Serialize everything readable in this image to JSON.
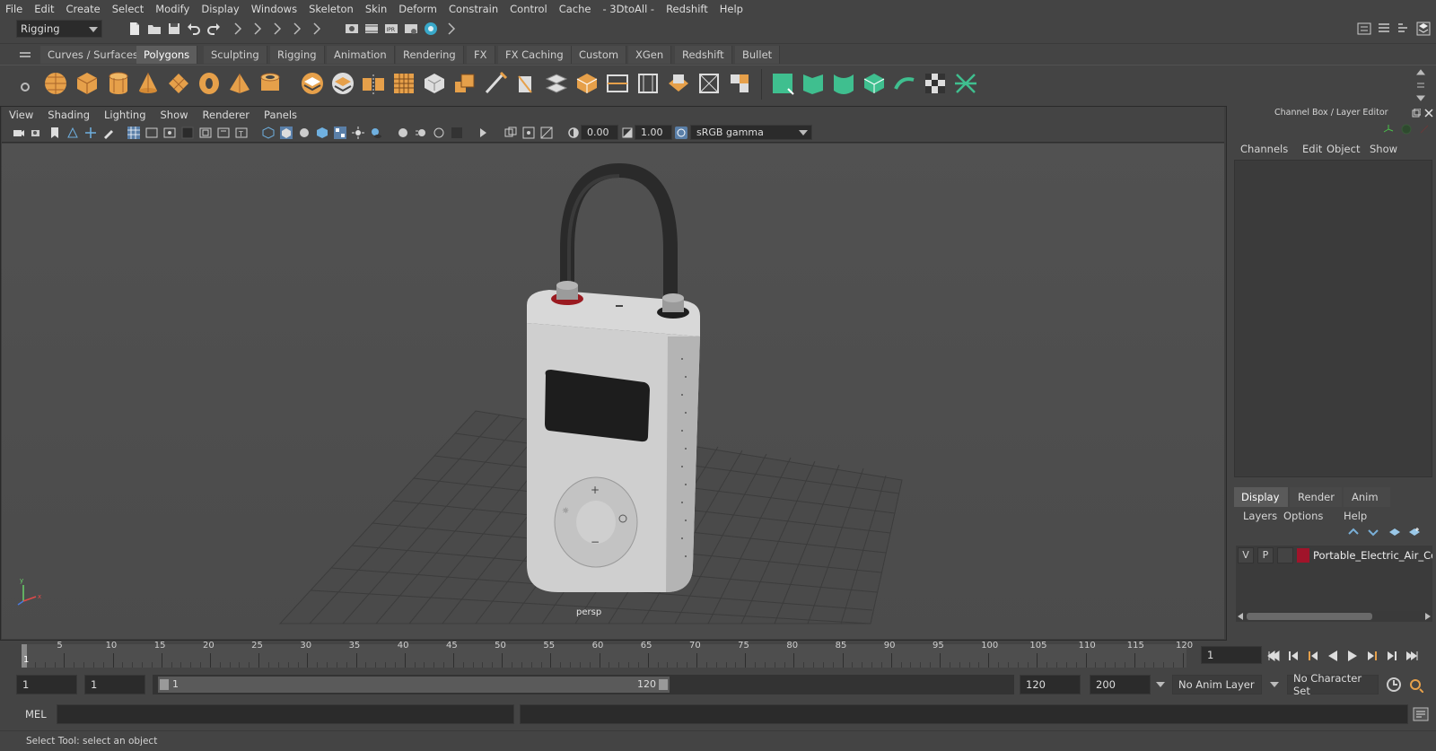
{
  "menu": [
    "File",
    "Edit",
    "Create",
    "Select",
    "Modify",
    "Display",
    "Windows",
    "Skeleton",
    "Skin",
    "Deform",
    "Constrain",
    "Control",
    "Cache",
    "- 3DtoAll -",
    "Redshift",
    "Help"
  ],
  "status": {
    "menu_set": "Rigging"
  },
  "shelf": {
    "tabs": [
      "Curves / Surfaces",
      "Polygons",
      "Sculpting",
      "Rigging",
      "Animation",
      "Rendering",
      "FX",
      "FX Caching",
      "Custom",
      "XGen",
      "Redshift",
      "Bullet"
    ],
    "active_tab": "Polygons"
  },
  "viewport": {
    "menu": [
      "View",
      "Shading",
      "Lighting",
      "Show",
      "Renderer",
      "Panels"
    ],
    "exposure": "0.00",
    "gamma": "1.00",
    "color_space": "sRGB gamma",
    "camera_label": "persp"
  },
  "right_panel": {
    "title": "Channel Box / Layer Editor",
    "channel_menu": [
      "Channels",
      "Edit",
      "Object",
      "Show"
    ],
    "layer_tabs": [
      "Display",
      "Render",
      "Anim"
    ],
    "active_layer_tab": "Display",
    "layer_menu": [
      "Layers",
      "Options",
      "Help"
    ],
    "layer": {
      "v": "V",
      "p": "P",
      "name": "Portable_Electric_Air_Cor",
      "color": "#a0142a"
    }
  },
  "timeline": {
    "ticks": [
      "5",
      "10",
      "15",
      "20",
      "25",
      "30",
      "35",
      "40",
      "45",
      "50",
      "55",
      "60",
      "65",
      "70",
      "75",
      "80",
      "85",
      "90",
      "95",
      "100",
      "105",
      "110",
      "115",
      "120"
    ],
    "current_marker": "1",
    "current_frame": "1"
  },
  "range": {
    "start": "1",
    "anim_start": "1",
    "slider_start": "1",
    "slider_end": "120",
    "end": "120",
    "anim_end": "200",
    "anim_layer": "No Anim Layer",
    "character_set": "No Character Set"
  },
  "command": {
    "label": "MEL"
  },
  "help_line": "Select Tool: select an object",
  "colors": {
    "accent_shelf_orange": "#e6a04a",
    "accent_shelf_green": "#3fbf8f",
    "active_tab": "#5d5d5d"
  }
}
